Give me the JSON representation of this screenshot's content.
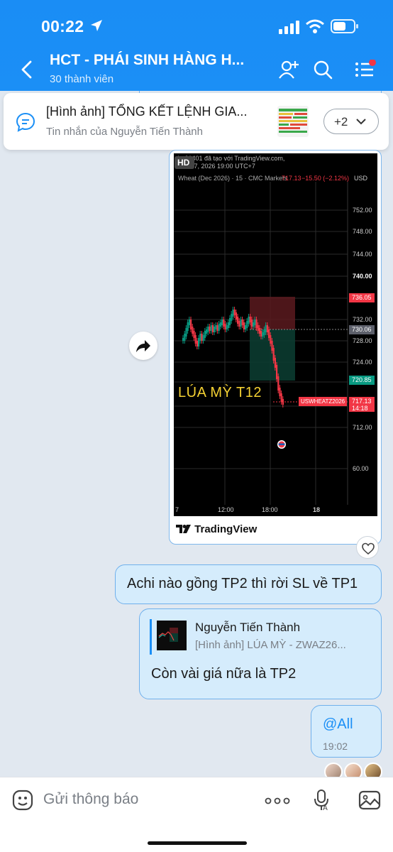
{
  "status_bar": {
    "time": "00:22"
  },
  "header": {
    "title": "HCT - PHÁI SINH HÀNG H...",
    "subtitle": "30 thành viên"
  },
  "pinned": {
    "title": "[Hình ảnh] TỔNG KẾT LỆNH GIA...",
    "subtitle": "Tin nhắn của Nguyễn Tiến Thành",
    "more_label": "+2"
  },
  "chart_image": {
    "watermark_line1": "th   t21401 đã tạo với TradingView.com,",
    "watermark_line2": "Th     9 17, 2026 19:00 UTC+7",
    "symbol_line": "Wheat (Dec 2026) · 15 · CMC Markets",
    "price_now": "717.13",
    "change": "−15.50 (−2.12%)",
    "currency": "USD",
    "overlay_text": "LÚA MỲ T12",
    "y_ticks": [
      "752.00",
      "748.00",
      "744.00",
      "740.00",
      "736.00",
      "732.00",
      "728.00",
      "724.00",
      "720.00",
      "716.00",
      "712.00",
      "60.00"
    ],
    "x_ticks": [
      "7",
      "12:00",
      "18:00",
      "18"
    ],
    "label_sl": "736.05",
    "label_entry": "730.06",
    "label_tp": "720.85",
    "label_symbol": "USWHEATZ2026",
    "label_price": "717.13",
    "label_time": "14:18",
    "hd_badge": "HD",
    "footer_logo": "TradingView"
  },
  "messages": [
    {
      "text": "Achi nào gồng TP2 thì rời SL về TP1"
    },
    {
      "quote_name": "Nguyễn Tiến Thành",
      "quote_text": "[Hình ảnh] LÚA MỲ - ZWAZ26...",
      "text": "Còn vài giá nữa là TP2"
    },
    {
      "text": "@All",
      "time": "19:02"
    }
  ],
  "input": {
    "placeholder": "Gửi thông báo"
  },
  "colors": {
    "accent": "#1b8ff6",
    "bubble": "#d5ecfc",
    "red": "#f23645",
    "green": "#089981"
  }
}
